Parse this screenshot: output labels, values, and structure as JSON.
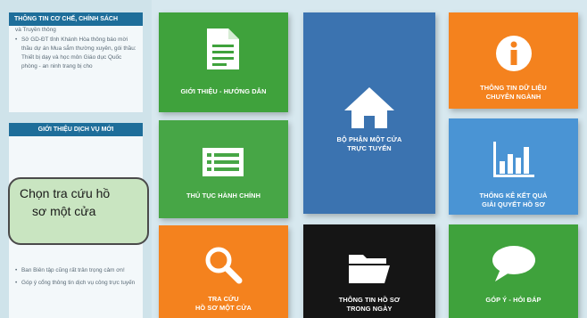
{
  "sidebar": {
    "panel1": {
      "title": "THÔNG TIN CƠ CHẾ, CHÍNH SÁCH",
      "subtitle": "và Truyền thông",
      "items": [
        "Sở GD-ĐT tỉnh Khánh Hòa thông báo mời thầu dự án Mua sắm thường xuyên, gói thầu: Thiết bị dạy và học môn Giáo dục Quốc phòng - an ninh trang bị cho"
      ]
    },
    "panel2": {
      "title": "GIỚI THIỆU DỊCH VỤ MỚI",
      "items": [
        "Ban Biên tập cũng rất trân trọng cảm ơn!",
        "Góp ý cổng thông tin dịch vụ công trực tuyến"
      ]
    }
  },
  "tiles": {
    "intro": {
      "label": "GIỚI THIỆU - HƯỚNG DẪN",
      "color": "#3fa23c"
    },
    "procedures": {
      "label": "THỦ TỤC HÀNH CHÍNH",
      "color": "#47a646"
    },
    "lookup": {
      "line1": "TRA CỨU",
      "line2": "HỒ SƠ MỘT CỬA",
      "color": "#f4821e"
    },
    "one_stop": {
      "line1": "BỘ PHẬN MỘT CỬA",
      "line2": "TRỰC TUYẾN",
      "color": "#3b73b0"
    },
    "daily": {
      "line1": "THÔNG TIN HỒ SƠ",
      "line2": "TRONG NGÀY",
      "color": "#151515"
    },
    "data_info": {
      "line1": "THÔNG TIN DỮ LIỆU",
      "line2": "CHUYÊN NGÀNH",
      "color": "#f4821e"
    },
    "stats": {
      "line1": "THỐNG KÊ KẾT QUẢ",
      "line2": "GIẢI QUYẾT HỒ SƠ",
      "color": "#4a94d4"
    },
    "feedback": {
      "label": "GÓP Ý - HỎI ĐÁP",
      "color": "#3fa23c"
    }
  },
  "callout": {
    "line1": "Chọn tra cứu hồ",
    "line2": "sơ một cửa"
  }
}
